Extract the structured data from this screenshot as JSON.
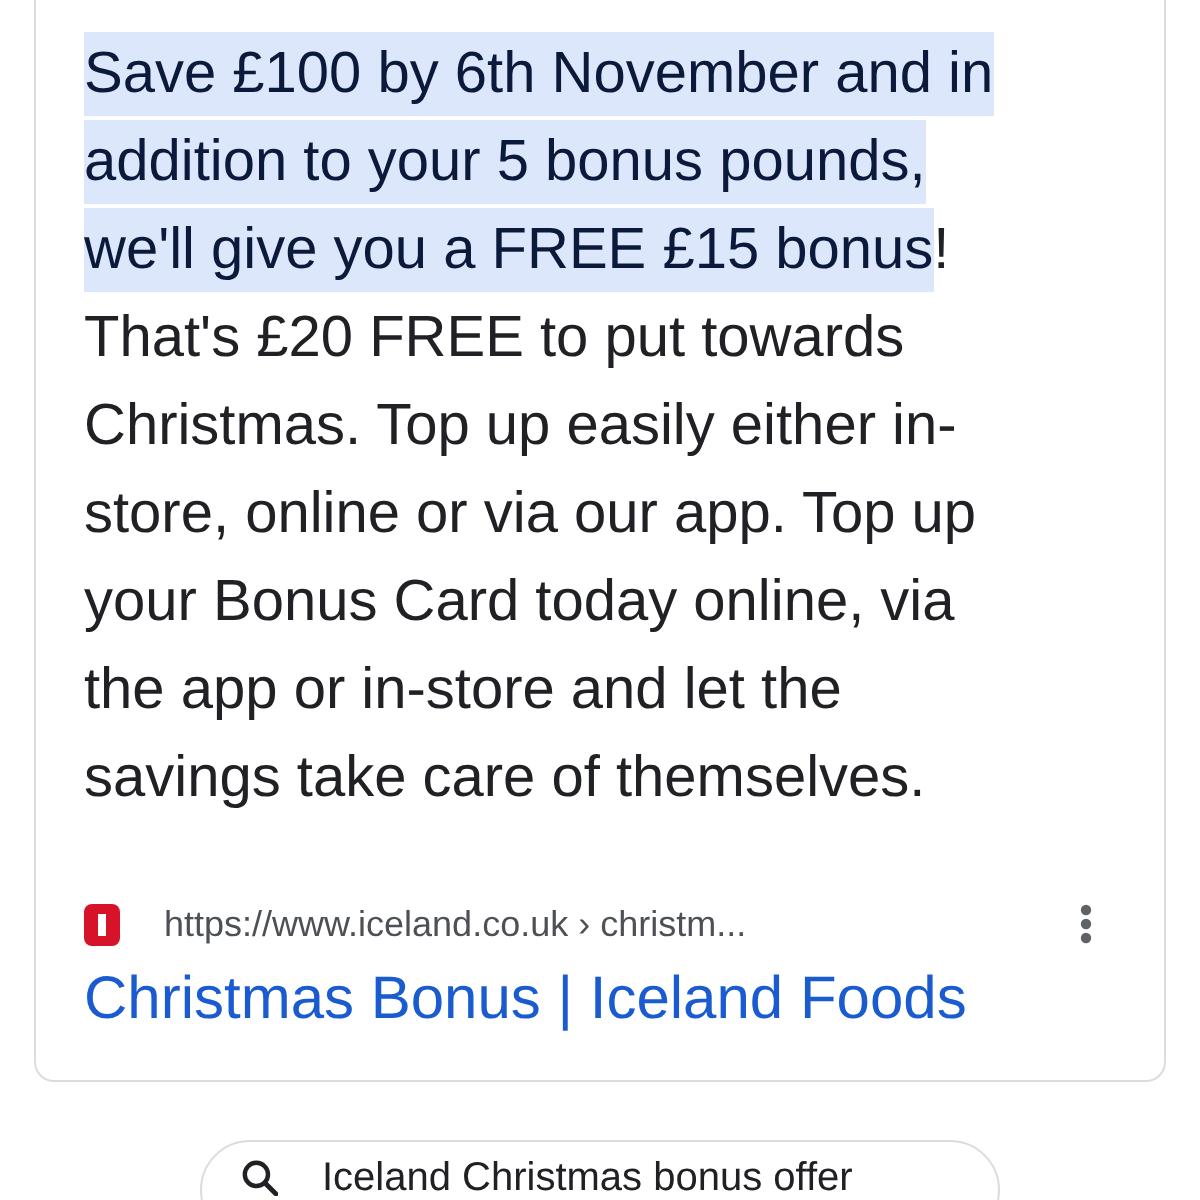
{
  "snippet": {
    "lines": [
      [
        {
          "text": "Save £100 by 6th November and in",
          "highlighted": true
        }
      ],
      [
        {
          "text": "addition to your 5 bonus pounds,",
          "highlighted": true
        }
      ],
      [
        {
          "text": "we'll give you a FREE £15 bonus",
          "highlighted": true
        },
        {
          "text": "!",
          "highlighted": false
        }
      ],
      [
        {
          "text": "That's £20 FREE to put towards",
          "highlighted": false
        }
      ],
      [
        {
          "text": "Christmas. Top up easily either in-",
          "highlighted": false
        }
      ],
      [
        {
          "text": "store, online or via our app. Top up",
          "highlighted": false
        }
      ],
      [
        {
          "text": "your Bonus Card today online, via",
          "highlighted": false
        }
      ],
      [
        {
          "text": "the app or in-store and let the",
          "highlighted": false
        }
      ],
      [
        {
          "text": "savings take care of themselves.",
          "highlighted": false
        }
      ]
    ]
  },
  "source": {
    "url": "https://www.iceland.co.uk › christm...",
    "title": "Christmas Bonus | Iceland Foods"
  },
  "related_search": {
    "text": "Iceland Christmas bonus offer"
  }
}
